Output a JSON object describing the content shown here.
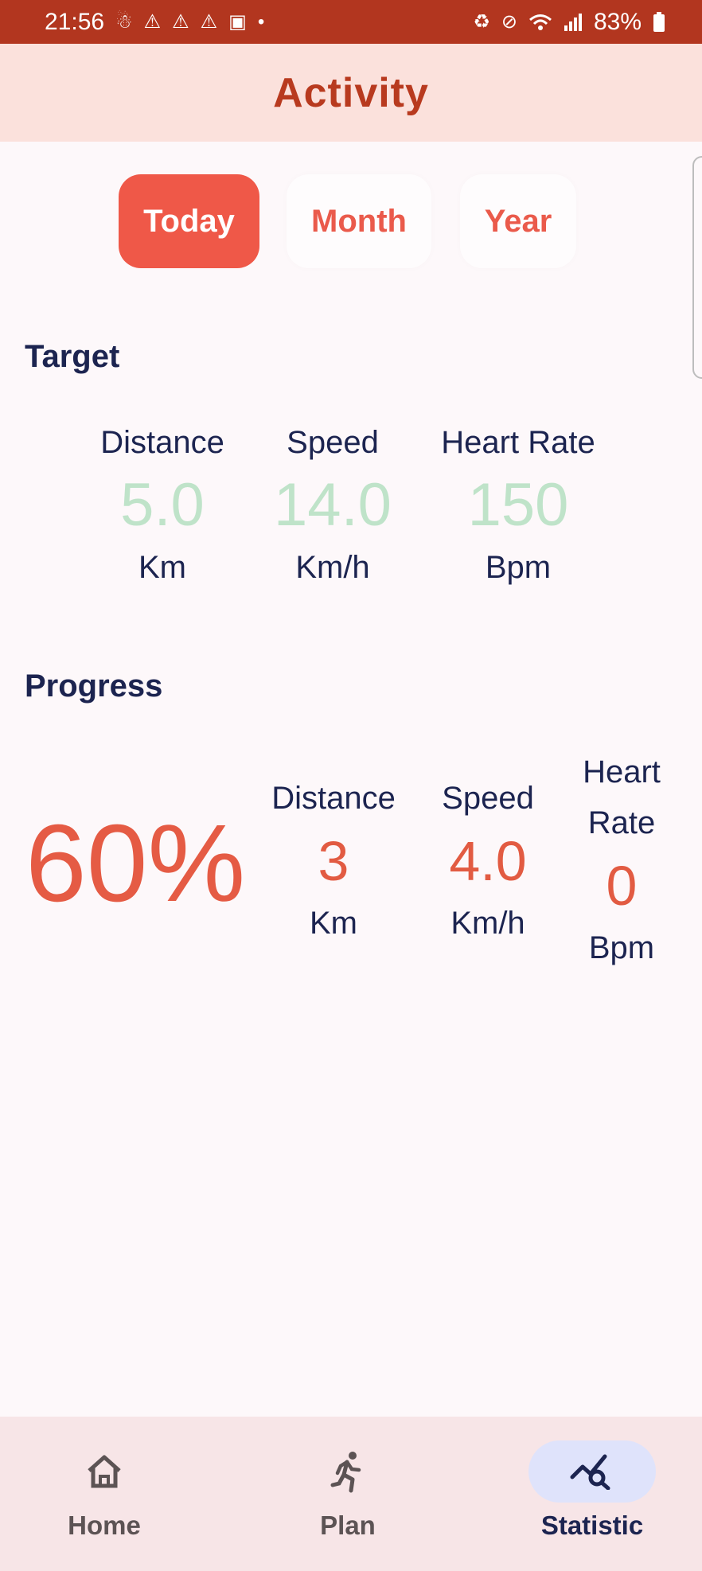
{
  "status_bar": {
    "time": "21:56",
    "battery": "83%",
    "left_icons": [
      "notification-icon",
      "warning-icon",
      "warning-icon",
      "warning-icon",
      "camera-icon",
      "dot-icon"
    ],
    "right_icons": [
      "battery-saver-icon",
      "mute-icon",
      "wifi-icon",
      "signal-icon",
      "battery-icon"
    ]
  },
  "app_bar": {
    "title": "Activity"
  },
  "tabs": [
    {
      "label": "Today",
      "active": true
    },
    {
      "label": "Month",
      "active": false
    },
    {
      "label": "Year",
      "active": false
    }
  ],
  "target": {
    "title": "Target",
    "distance": {
      "label": "Distance",
      "value": "5.0",
      "unit": "Km"
    },
    "speed": {
      "label": "Speed",
      "value": "14.0",
      "unit": "Km/h"
    },
    "heart_rate": {
      "label": "Heart Rate",
      "value": "150",
      "unit": "Bpm"
    }
  },
  "progress": {
    "title": "Progress",
    "percent": "60%",
    "distance": {
      "label": "Distance",
      "value": "3",
      "unit": "Km"
    },
    "speed": {
      "label": "Speed",
      "value": "4.0",
      "unit": "Km/h"
    },
    "heart_rate": {
      "label_line1": "Heart",
      "label_line2": "Rate",
      "value": "0",
      "unit": "Bpm"
    }
  },
  "bottom_nav": [
    {
      "label": "Home",
      "icon": "home-icon",
      "active": false
    },
    {
      "label": "Plan",
      "icon": "running-icon",
      "active": false
    },
    {
      "label": "Statistic",
      "icon": "statistic-icon",
      "active": true
    }
  ],
  "colors": {
    "status_bar": "#b2361f",
    "app_bar": "#fbe1dc",
    "accent": "#ef5848",
    "target_value": "#bfe3c9",
    "progress_value": "#e25b42",
    "text_dark": "#1c2450"
  }
}
